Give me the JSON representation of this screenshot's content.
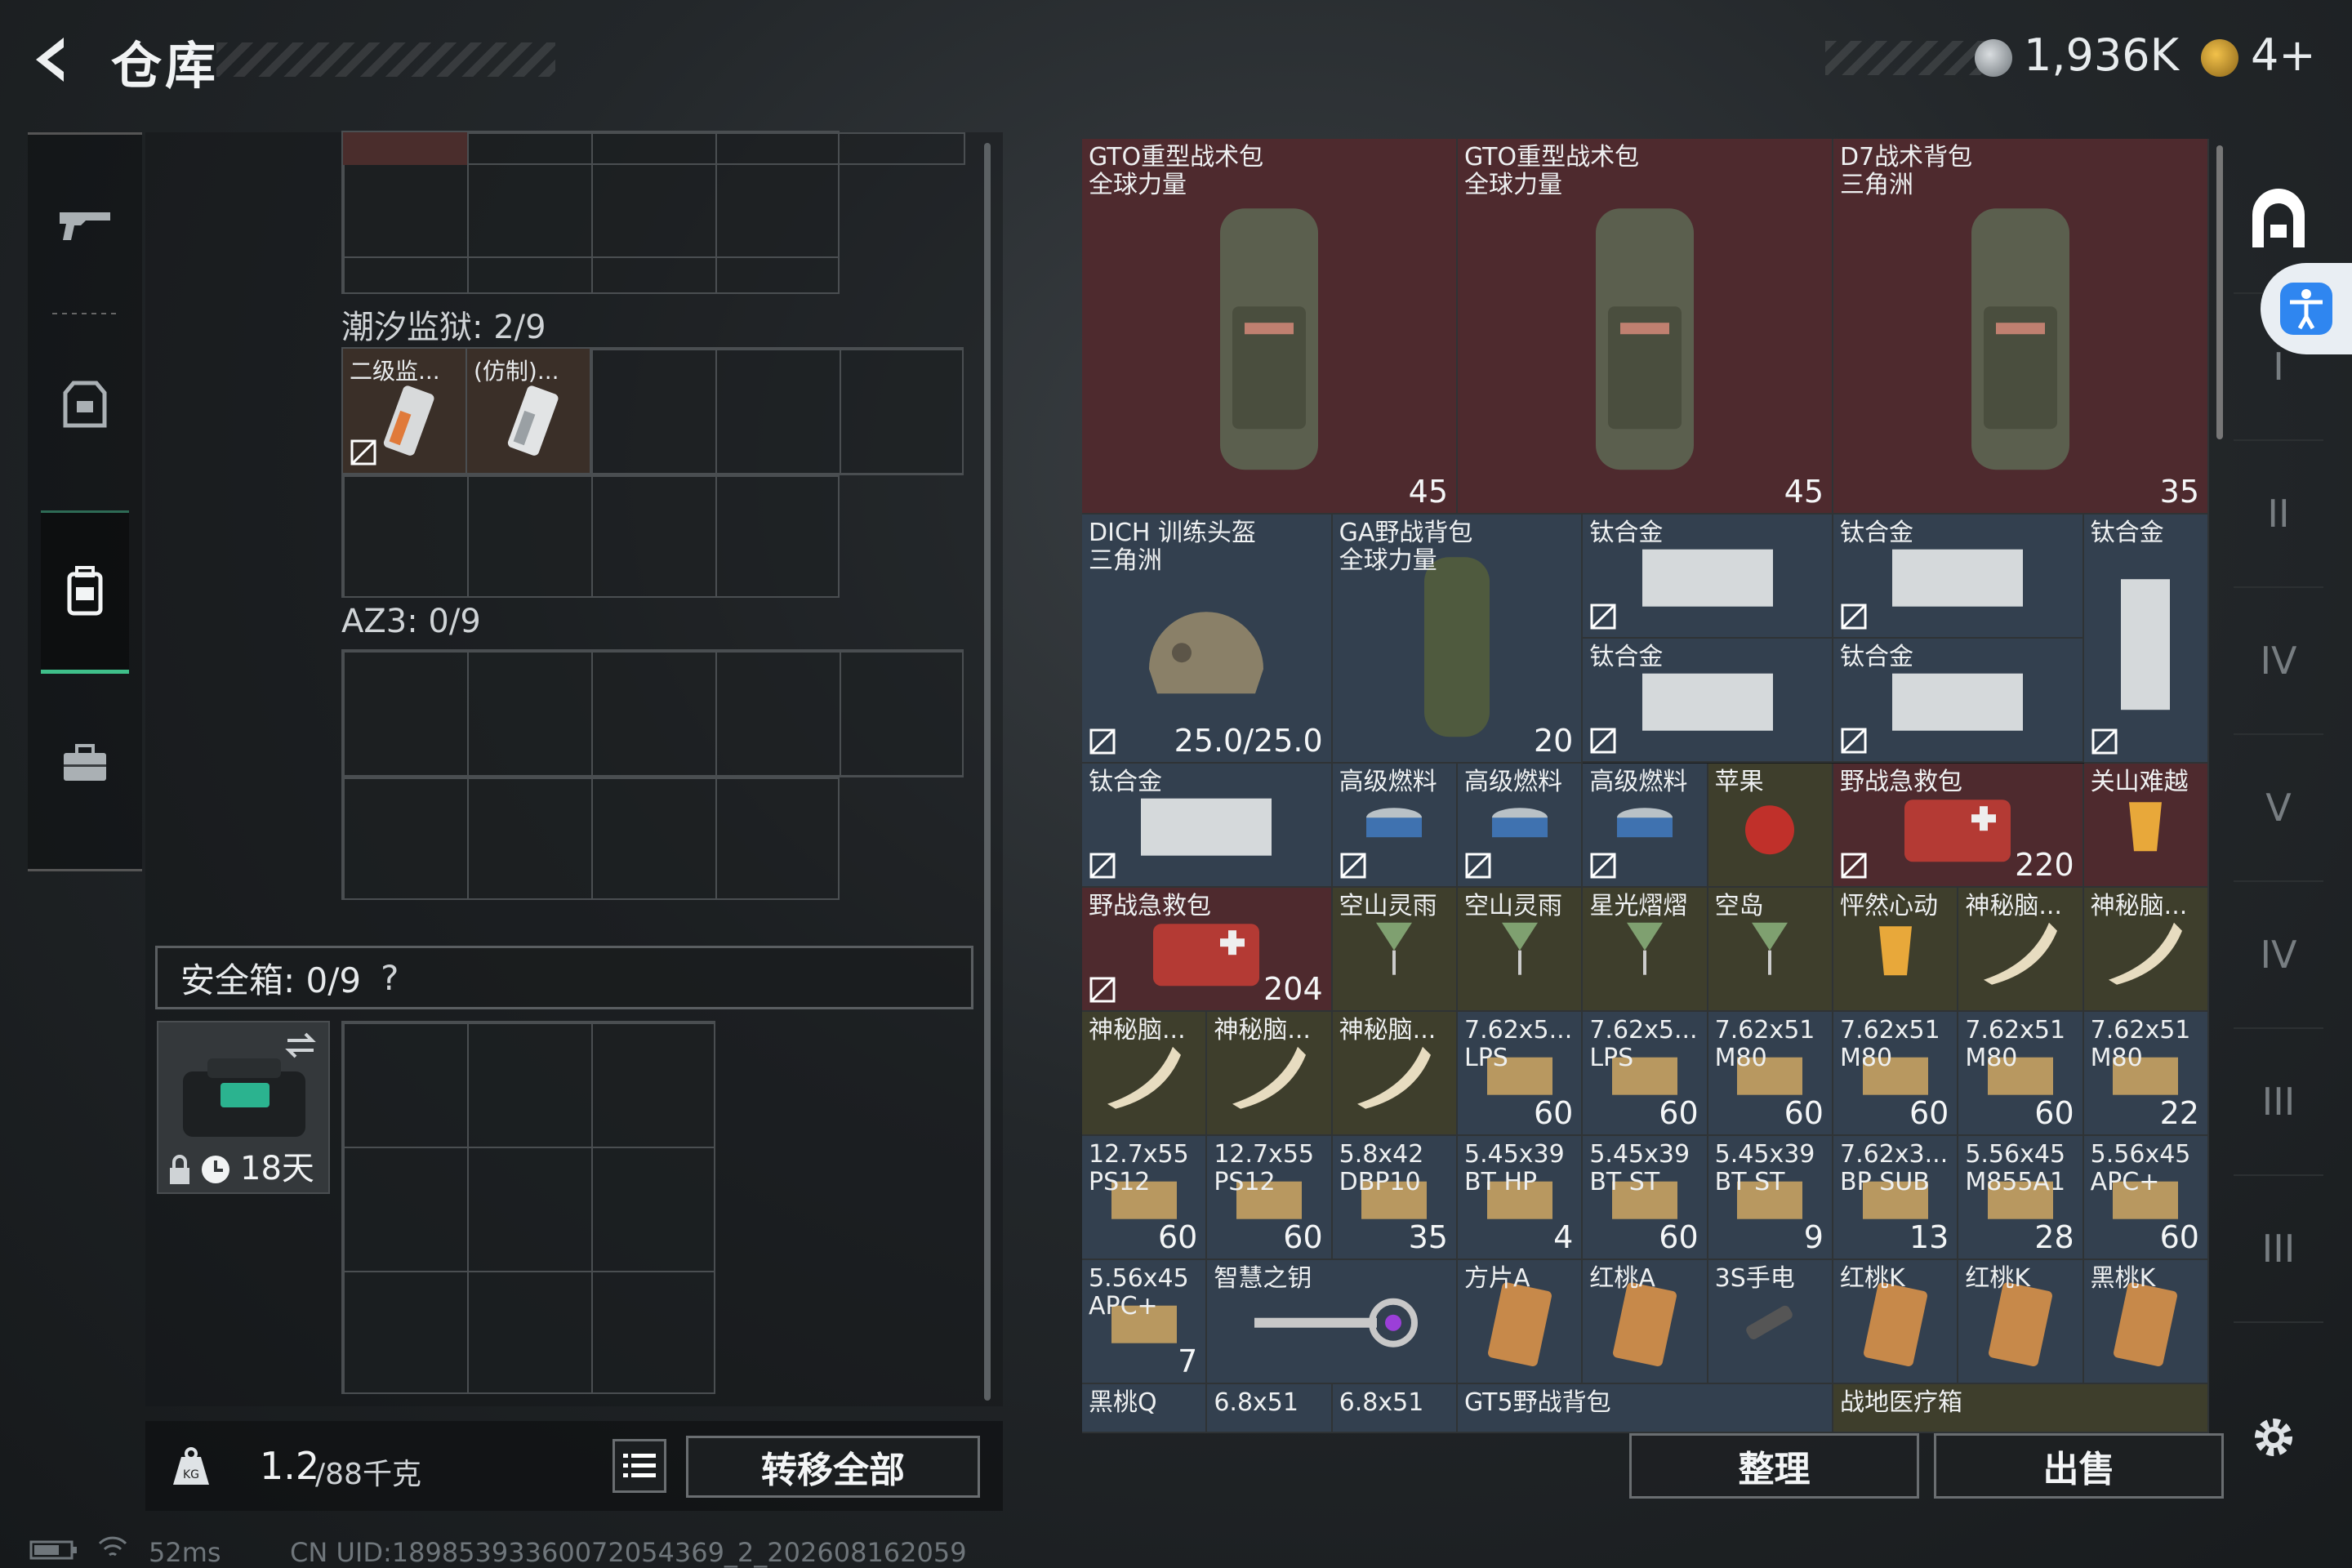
{
  "header": {
    "title": "仓库",
    "currency_amount": "1,936K",
    "token_amount": "4+"
  },
  "left_nav": {
    "items": [
      "weapon-icon",
      "armor-icon",
      "backpack-icon",
      "briefcase-icon"
    ]
  },
  "containers": {
    "tide_prison": {
      "label": "潮汐监狱: 2/9",
      "items": [
        "二级监...",
        "(仿制)..."
      ]
    },
    "az3": {
      "label": "AZ3: 0/9"
    }
  },
  "safe_box": {
    "label": "安全箱: 0/9",
    "help": "?",
    "timer": "18天"
  },
  "bottom_left": {
    "weight": "1.2",
    "weight_cap": "/88千克",
    "transfer_all": "转移全部"
  },
  "status": {
    "ping": "52ms",
    "uid": "CN UID:18985393360072054369_2_202608162059"
  },
  "stash": {
    "items": [
      {
        "name": "GTO重型战术包\n全球力量",
        "count": "45"
      },
      {
        "name": "GTO重型战术包\n全球力量",
        "count": "45"
      },
      {
        "name": "D7战术背包\n三角洲",
        "count": "35"
      },
      {
        "name": "DICH 训练头盔\n三角洲",
        "count": "25.0/25.0"
      },
      {
        "name": "GA野战背包\n全球力量",
        "count": "20"
      },
      {
        "name": "钛合金",
        "count": ""
      },
      {
        "name": "钛合金",
        "count": ""
      },
      {
        "name": "钛合金",
        "count": ""
      },
      {
        "name": "钛合金",
        "count": ""
      },
      {
        "name": "钛合金",
        "count": ""
      },
      {
        "name": "钛合金",
        "count": ""
      },
      {
        "name": "高级燃料",
        "count": ""
      },
      {
        "name": "高级燃料",
        "count": ""
      },
      {
        "name": "高级燃料",
        "count": ""
      },
      {
        "name": "苹果",
        "count": ""
      },
      {
        "name": "野战急救包",
        "count": "220"
      },
      {
        "name": "关山难越",
        "count": ""
      },
      {
        "name": "野战急救包",
        "count": "204"
      },
      {
        "name": "空山灵雨",
        "count": ""
      },
      {
        "name": "空山灵雨",
        "count": ""
      },
      {
        "name": "星光熠熠",
        "count": ""
      },
      {
        "name": "空岛",
        "count": ""
      },
      {
        "name": "怦然心动",
        "count": ""
      },
      {
        "name": "神秘脑...",
        "count": ""
      },
      {
        "name": "神秘脑...",
        "count": ""
      },
      {
        "name": "神秘脑...",
        "count": ""
      },
      {
        "name": "神秘脑...",
        "count": ""
      },
      {
        "name": "神秘脑...",
        "count": ""
      },
      {
        "name": "7.62x5...\nLPS",
        "count": "60"
      },
      {
        "name": "7.62x5...\nLPS",
        "count": "60"
      },
      {
        "name": "7.62x51\nM80",
        "count": "60"
      },
      {
        "name": "7.62x51\nM80",
        "count": "60"
      },
      {
        "name": "7.62x51\nM80",
        "count": "60"
      },
      {
        "name": "7.62x51\nM80",
        "count": "22"
      },
      {
        "name": "12.7x55\nPS12",
        "count": "60"
      },
      {
        "name": "12.7x55\nPS12",
        "count": "60"
      },
      {
        "name": "5.8x42\nDBP10",
        "count": "35"
      },
      {
        "name": "5.45x39\nBT HP",
        "count": "4"
      },
      {
        "name": "5.45x39\nBT ST",
        "count": "60"
      },
      {
        "name": "5.45x39\nBT ST",
        "count": "9"
      },
      {
        "name": "7.62x3...\nBP SUB",
        "count": "13"
      },
      {
        "name": "5.56x45\nM855A1",
        "count": "28"
      },
      {
        "name": "5.56x45\nAPC+",
        "count": "60"
      },
      {
        "name": "5.56x45\nAPC+",
        "count": "7"
      },
      {
        "name": "智慧之钥",
        "count": ""
      },
      {
        "name": "方片A",
        "count": ""
      },
      {
        "name": "红桃A",
        "count": ""
      },
      {
        "name": "3S手电",
        "count": ""
      },
      {
        "name": "红桃K",
        "count": ""
      },
      {
        "name": "红桃K",
        "count": ""
      },
      {
        "name": "黑桃K",
        "count": ""
      },
      {
        "name": "黑桃Q",
        "count": ""
      },
      {
        "name": "6.8x51",
        "count": ""
      },
      {
        "name": "6.8x51",
        "count": ""
      },
      {
        "name": "GT5野战背包",
        "count": ""
      },
      {
        "name": "战地医疗箱",
        "count": ""
      }
    ],
    "sort_label": "整理",
    "sell_label": "出售"
  },
  "right_nav": {
    "items": [
      "shelter-icon",
      "I",
      "II",
      "IV",
      "V",
      "IV",
      "III",
      "III"
    ]
  },
  "colors": {
    "accent_green": "#3fbf8a",
    "item_red": "#4e2a2e",
    "item_blue": "#33404f",
    "accessibility_blue": "#2f86f0"
  }
}
